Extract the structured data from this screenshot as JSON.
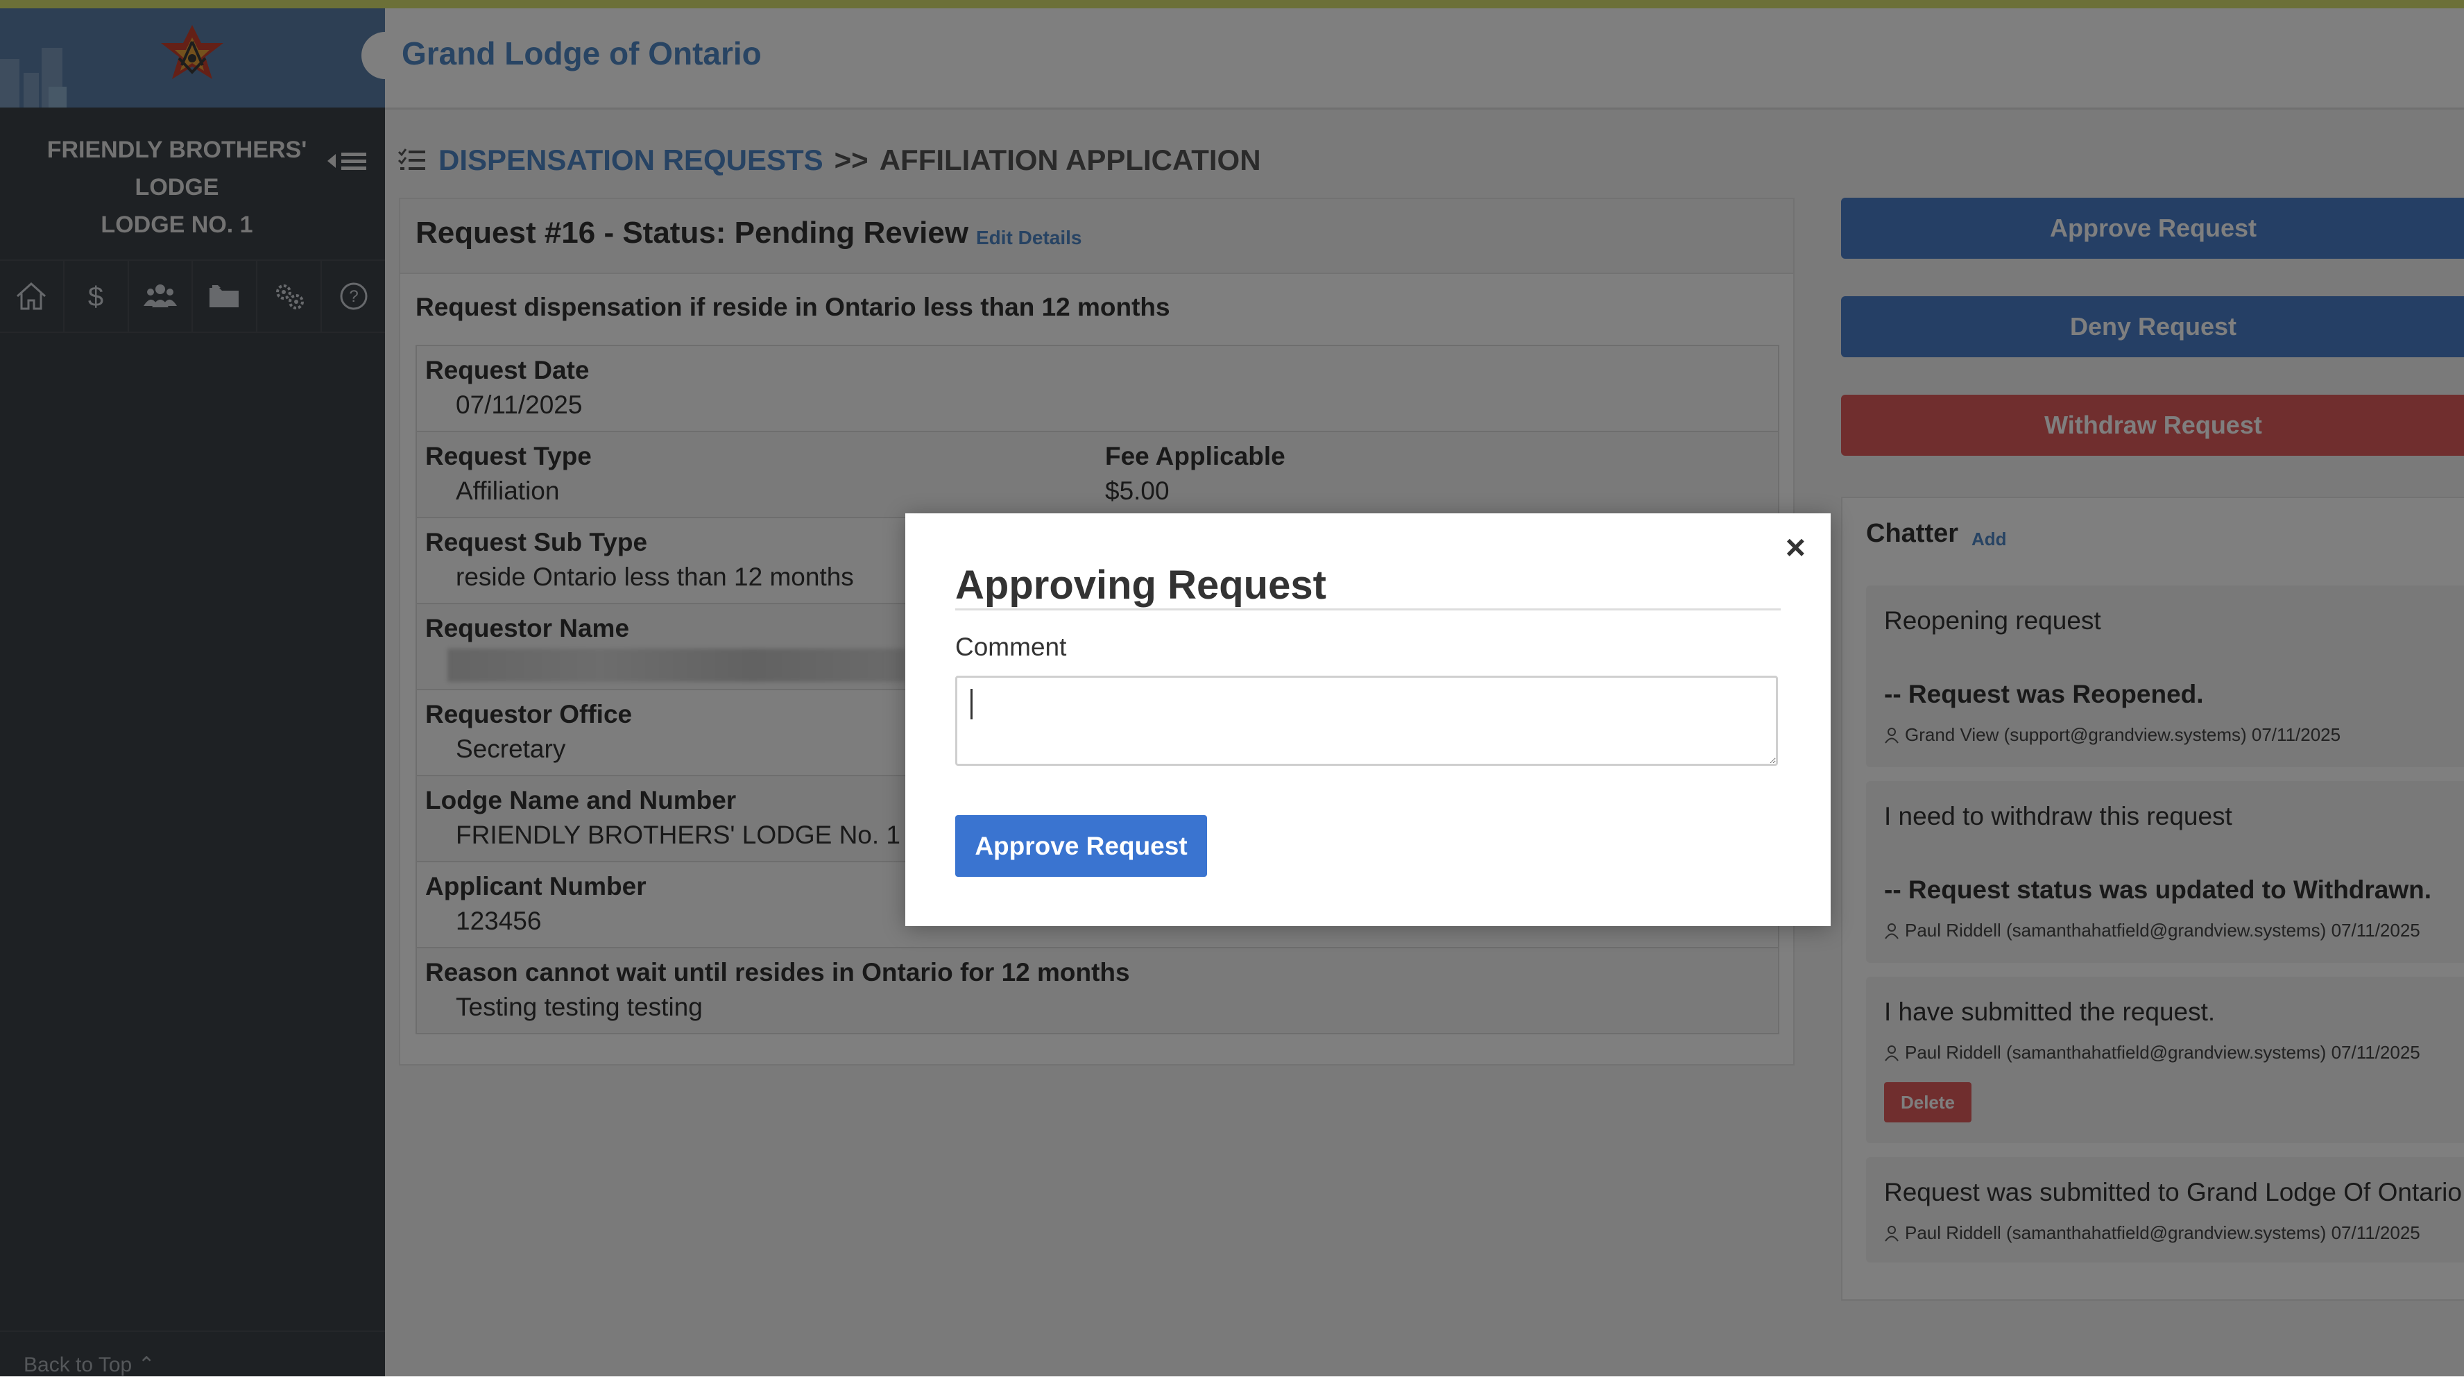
{
  "header": {
    "site_title": "Grand Lodge of Ontario"
  },
  "sidebar": {
    "lodge_name_line1": "FRIENDLY BROTHERS'",
    "lodge_name_line2": "LODGE",
    "lodge_name_line3": "LODGE NO. 1",
    "nav_icons": [
      "home-icon",
      "dollar-icon",
      "members-icon",
      "folder-icon",
      "settings-icon",
      "help-icon"
    ],
    "back_to_top": "Back to Top"
  },
  "breadcrumb": {
    "parent": "DISPENSATION REQUESTS",
    "separator": ">>",
    "current": "AFFILIATION APPLICATION"
  },
  "request": {
    "title": "Request #16 - Status: Pending Review",
    "edit_link": "Edit Details",
    "description": "Request dispensation if reside in Ontario less than 12 months",
    "fields": {
      "request_date_label": "Request Date",
      "request_date": "07/11/2025",
      "request_type_label": "Request Type",
      "request_type": "Affiliation",
      "fee_label": "Fee Applicable",
      "fee": "$5.00",
      "sub_type_label": "Request Sub Type",
      "sub_type": "reside Ontario less than 12 months",
      "requestor_name_label": "Requestor Name",
      "requestor_office_label": "Requestor Office",
      "requestor_office": "Secretary",
      "lodge_label": "Lodge Name and Number",
      "lodge": "FRIENDLY BROTHERS' LODGE No. 1",
      "applicant_number_label": "Applicant Number",
      "applicant_number": "123456",
      "reason_label": "Reason cannot wait until resides in Ontario for 12 months",
      "reason": "Testing testing testing"
    }
  },
  "actions": {
    "approve": "Approve Request",
    "deny": "Deny Request",
    "withdraw": "Withdraw Request"
  },
  "chatter": {
    "title": "Chatter",
    "add": "Add",
    "items": [
      {
        "text": "Reopening request",
        "status": "-- Request was Reopened.",
        "meta": "Grand View (support@grandview.systems) 07/11/2025"
      },
      {
        "text": "I need to withdraw this request",
        "status": "-- Request status was updated to Withdrawn.",
        "meta": "Paul Riddell (samanthahatfield@grandview.systems) 07/11/2025"
      },
      {
        "text": "I have submitted the request.",
        "meta": "Paul Riddell (samanthahatfield@grandview.systems) 07/11/2025",
        "delete": "Delete"
      },
      {
        "text": "Request was submitted to Grand Lodge Of Ontario",
        "meta": "Paul Riddell (samanthahatfield@grandview.systems) 07/11/2025"
      }
    ]
  },
  "modal": {
    "title": "Approving Request",
    "comment_label": "Comment",
    "comment_value": "",
    "submit": "Approve Request",
    "close": "×"
  },
  "colors": {
    "accent_blue": "#4a7fcb",
    "danger_red": "#e05d5d",
    "sidebar_bg": "#3d4248",
    "link_blue": "#4f86c6"
  }
}
